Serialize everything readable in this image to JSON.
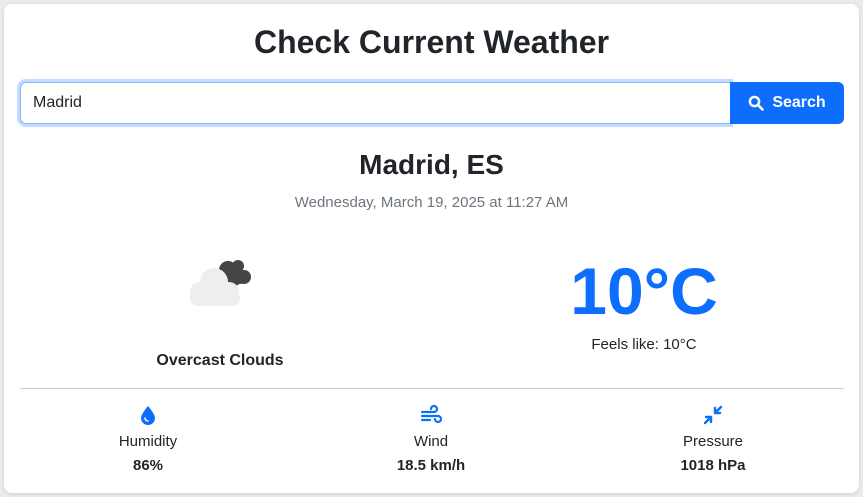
{
  "title": "Check Current Weather",
  "search": {
    "value": "Madrid",
    "button_label": "Search"
  },
  "location": {
    "city": "Madrid, ES",
    "datetime": "Wednesday, March 19, 2025 at 11:27 AM"
  },
  "current": {
    "condition": "Overcast Clouds",
    "condition_icon": "overcast-clouds-icon",
    "temperature": "10°C",
    "feels_like": "Feels like: 10°C"
  },
  "stats": [
    {
      "label": "Humidity",
      "value": "86%",
      "icon": "droplet-icon"
    },
    {
      "label": "Wind",
      "value": "18.5 km/h",
      "icon": "wind-icon"
    },
    {
      "label": "Pressure",
      "value": "1018 hPa",
      "icon": "pressure-icon"
    }
  ],
  "colors": {
    "accent": "#0d6efd",
    "text": "#212529",
    "muted": "#6c757d",
    "page_bg": "#e9ecef"
  }
}
